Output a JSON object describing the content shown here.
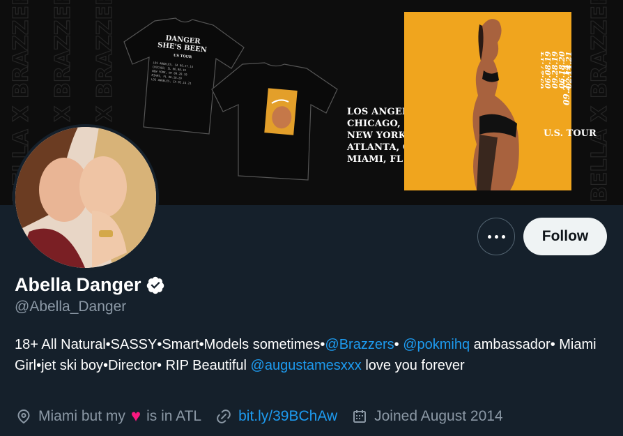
{
  "banner": {
    "watermark": "BELLA X BRAZZERS",
    "shirt_front_title": "DANGER\nSHE'S BEEN",
    "shirt_front_sub": "US TOUR",
    "shirt_front_lines": [
      "LOS ANGELES, CA   09.27.14",
      "CHICAGO, IL   06.08.19",
      "NEW YORK, NY   09.28.19",
      "MIAMI, FL   06.18.20",
      "LOS ANGELES, CA   02.14.21"
    ],
    "cities": [
      "LOS ANGELES, CA",
      "CHICAGO, IL",
      "NEW YORK, NY",
      "ATLANTA, GA",
      "MIAMI, FL"
    ],
    "dates": [
      "09.27.14",
      "06.08.19",
      "09.28.19",
      "06.18.20",
      "02.14.21"
    ],
    "tour": "U.S. TOUR"
  },
  "profile": {
    "name": "Abella Danger",
    "handle": "@Abella_Danger",
    "follow_label": "Follow",
    "bio": {
      "p1": "18+ All Natural•SASSY•Smart•Models sometimes•",
      "m1": "@Brazzers",
      "p2": "• ",
      "m2": "@pokmihq",
      "p3": " ambassador• Miami Girl•jet ski boy•Director• RIP Beautiful ",
      "m3": "@augustamesxxx",
      "p4": " love you forever"
    },
    "location_before": "Miami but my",
    "location_after": "is in ATL",
    "heart": "♥",
    "url": "bit.ly/39BChAw",
    "joined": "Joined August 2014"
  },
  "colors": {
    "background": "#15202b",
    "link": "#1d9bf0",
    "secondary_text": "#8b98a5",
    "heart": "#f91880",
    "poster": "#f0a51e"
  },
  "icons": [
    "more-icon",
    "verified-badge-icon",
    "location-icon",
    "link-icon",
    "calendar-icon"
  ]
}
